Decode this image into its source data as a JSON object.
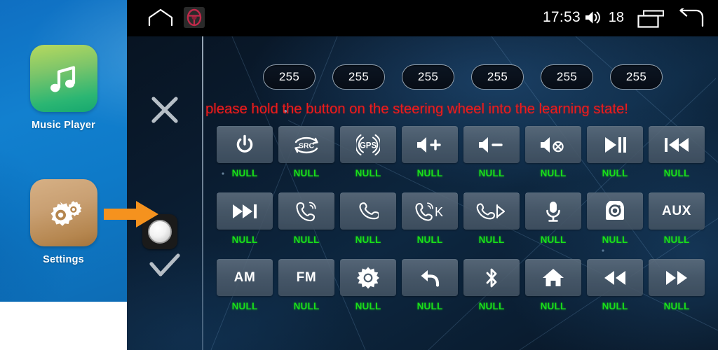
{
  "launcher": {
    "apps": [
      {
        "label": "Music Player",
        "icon": "music-note-icon",
        "color": "#2bb673"
      },
      {
        "label": "Settings",
        "icon": "gears-icon",
        "color": "#b5864f"
      }
    ],
    "pointer": {
      "icon": "orange-arrow-icon",
      "color": "#f5921e"
    }
  },
  "statusbar": {
    "home_icon": "home-outline-icon",
    "app_icon": "steering-wheel-icon",
    "time": "17:53",
    "volume_icon": "volume-icon",
    "volume_value": "18",
    "recents_icon": "recent-apps-icon",
    "back_icon": "back-arrow-icon"
  },
  "screen": {
    "cancel_icon": "close-x-icon",
    "confirm_icon": "check-icon",
    "wheel_button_icon": "steering-knob-icon",
    "warning_text": "please hold the button on the steering wheel into the learning state!",
    "warning_color": "#ee1b1b",
    "label_color": "#19e019",
    "pills": [
      {
        "value": "255"
      },
      {
        "value": "255"
      },
      {
        "value": "255"
      },
      {
        "value": "255"
      },
      {
        "value": "255"
      },
      {
        "value": "255"
      }
    ],
    "grid": [
      [
        {
          "icon": "power-icon",
          "label": "NULL"
        },
        {
          "icon": "src-icon",
          "label": "NULL"
        },
        {
          "icon": "gps-icon",
          "label": "NULL"
        },
        {
          "icon": "volume-up-icon",
          "label": "NULL"
        },
        {
          "icon": "volume-down-icon",
          "label": "NULL"
        },
        {
          "icon": "volume-mute-icon",
          "label": "NULL"
        },
        {
          "icon": "play-pause-icon",
          "label": "NULL"
        },
        {
          "icon": "previous-track-icon",
          "label": "NULL"
        }
      ],
      [
        {
          "icon": "next-track-icon",
          "label": "NULL"
        },
        {
          "icon": "call-answer-icon",
          "label": "NULL"
        },
        {
          "icon": "call-hangup-icon",
          "label": "NULL"
        },
        {
          "icon": "call-answer-k-icon",
          "label": "NULL"
        },
        {
          "icon": "call-hangup-k-icon",
          "label": "NULL"
        },
        {
          "icon": "microphone-icon",
          "label": "NULL"
        },
        {
          "icon": "camera-icon",
          "label": "NULL"
        },
        {
          "icon": "aux-icon",
          "label": "NULL",
          "text": "AUX"
        }
      ],
      [
        {
          "icon": "am-icon",
          "label": "NULL",
          "text": "AM"
        },
        {
          "icon": "fm-icon",
          "label": "NULL",
          "text": "FM"
        },
        {
          "icon": "brightness-icon",
          "label": "NULL"
        },
        {
          "icon": "return-arrow-icon",
          "label": "NULL"
        },
        {
          "icon": "bluetooth-icon",
          "label": "NULL"
        },
        {
          "icon": "home-icon",
          "label": "NULL"
        },
        {
          "icon": "rewind-icon",
          "label": "NULL"
        },
        {
          "icon": "fast-forward-icon",
          "label": "NULL"
        }
      ]
    ]
  }
}
